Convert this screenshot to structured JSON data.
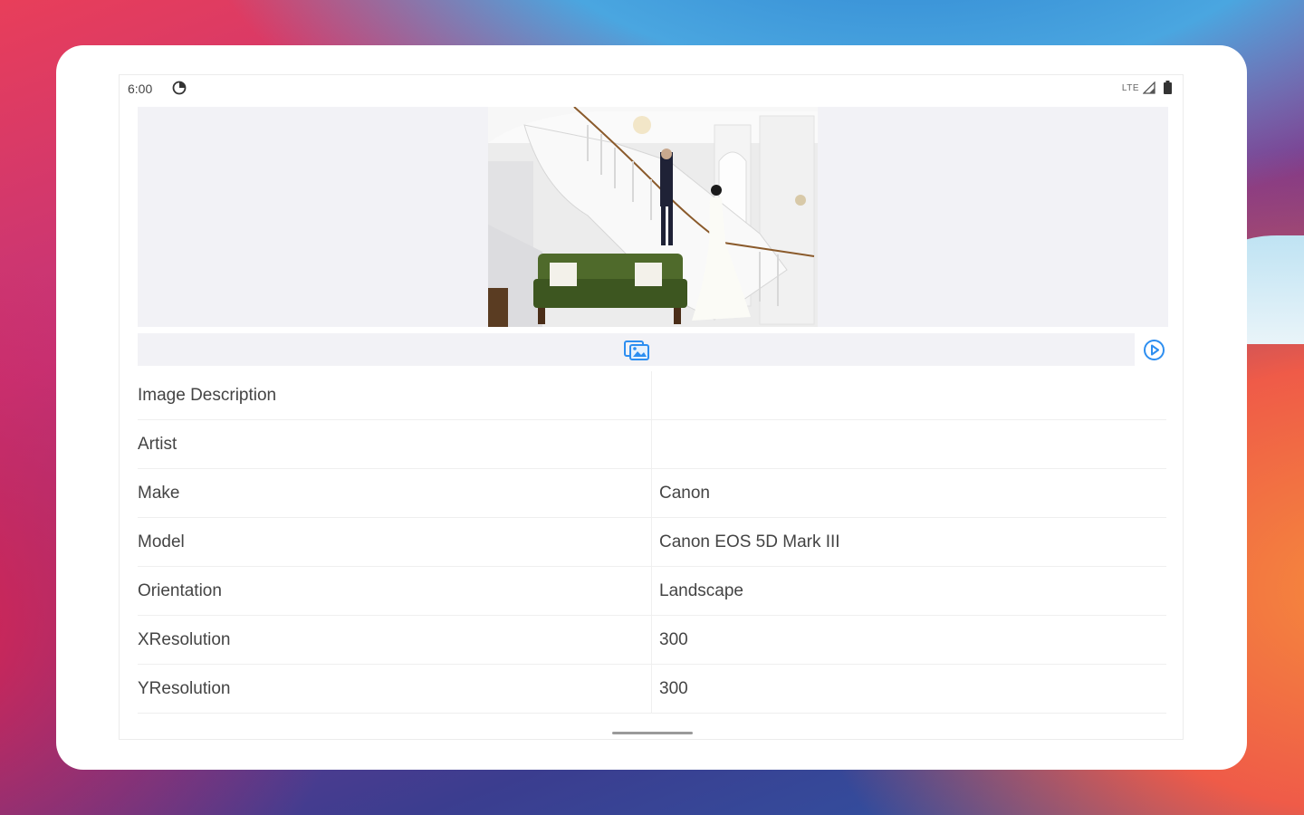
{
  "status_bar": {
    "time": "6:00",
    "network": "LTE",
    "icons": [
      "sync-icon",
      "signal-icon",
      "battery-icon"
    ]
  },
  "toolbar": {
    "icons": [
      "compare-icon",
      "play-icon"
    ],
    "accent_color": "#2d8ef0"
  },
  "exif_table": {
    "rows": [
      {
        "key": "Image Description",
        "value": ""
      },
      {
        "key": "Artist",
        "value": ""
      },
      {
        "key": "Make",
        "value": "Canon"
      },
      {
        "key": "Model",
        "value": "Canon EOS 5D Mark III"
      },
      {
        "key": "Orientation",
        "value": "Landscape"
      },
      {
        "key": "XResolution",
        "value": "300"
      },
      {
        "key": "YResolution",
        "value": "300"
      }
    ]
  },
  "colors": {
    "preview_background": "#f2f2f6",
    "text": "#444444"
  }
}
